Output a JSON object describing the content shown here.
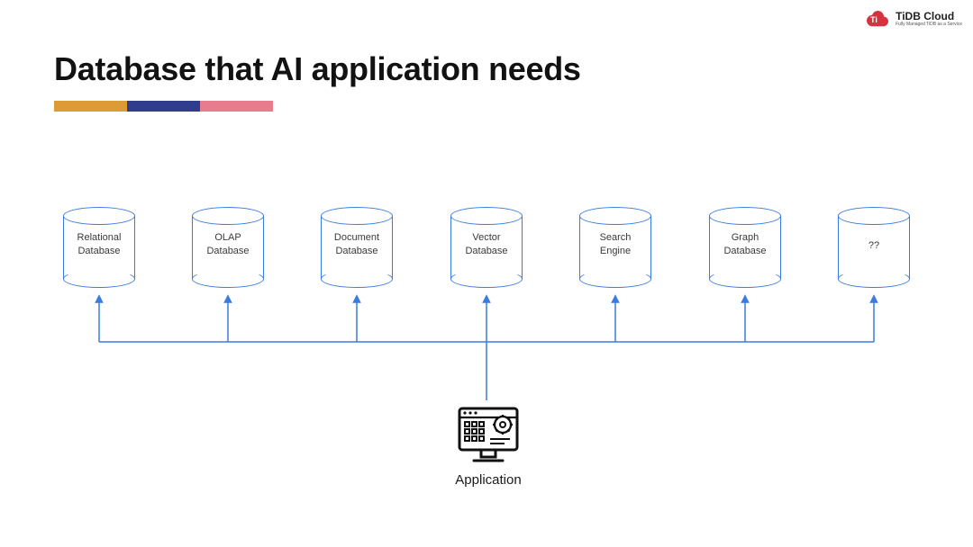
{
  "logo": {
    "name": "TiDB Cloud",
    "tagline": "Fully Managed TiDB as a Service"
  },
  "title": "Database that AI application needs",
  "colors": {
    "accent1": "#dc9b34",
    "accent2": "#303d8c",
    "accent3": "#e77d8c",
    "connector": "#3b7be0"
  },
  "databases": [
    {
      "label": "Relational\nDatabase"
    },
    {
      "label": "OLAP\nDatabase"
    },
    {
      "label": "Document\nDatabase"
    },
    {
      "label": "Vector\nDatabase"
    },
    {
      "label": "Search\nEngine"
    },
    {
      "label": "Graph\nDatabase"
    },
    {
      "label": "??"
    }
  ],
  "application_label": "Application"
}
